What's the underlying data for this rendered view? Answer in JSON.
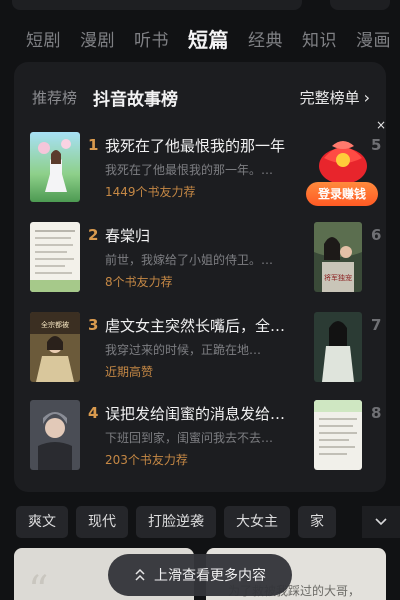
{
  "category_tabs": [
    "短剧",
    "漫剧",
    "听书",
    "短篇",
    "经典",
    "知识",
    "漫画"
  ],
  "active_tab": "短篇",
  "ranking": {
    "left_label": "推荐榜",
    "title": "抖音故事榜",
    "full_list_label": "完整榜单",
    "full_list_chevron": "›",
    "items": [
      {
        "rank": "1",
        "title": "我死在了他最恨我的那一年",
        "desc": "我死在了他最恨我的那一年。…",
        "meta": "1449个书友力荐",
        "right_rank": "5"
      },
      {
        "rank": "2",
        "title": "春棠归",
        "desc": "前世，我嫁给了小姐的侍卫。…",
        "meta": "8个书友力荐",
        "right_rank": "6"
      },
      {
        "rank": "3",
        "title": "虐文女主突然长嘴后，全…",
        "desc": "我穿过来的时候，正跪在地…",
        "meta": "近期高赞",
        "right_rank": "7"
      },
      {
        "rank": "4",
        "title": "误把发给闺蜜的消息发给…",
        "desc": "下班回到家，闺蜜问我去不去…",
        "meta": "203个书友力荐",
        "right_rank": "8"
      }
    ]
  },
  "cover_texts": {
    "item3_cover_title": "全宗都被",
    "right6_cover_title": "将军独宠"
  },
  "promo": {
    "button_label": "登录赚钱",
    "close_glyph": "×"
  },
  "filter_chips": [
    "爽文",
    "现代",
    "打脸逆袭",
    "大女主",
    "家"
  ],
  "bottom_card_right_text": "为了救被我踩过的大哥，",
  "scroll_hint": {
    "label": "上滑查看更多内容"
  },
  "colors": {
    "background": "#111214",
    "panel": "#1c1d20",
    "rank_accent": "#d99a4e",
    "meta_accent": "#c58845",
    "promo_orange": "#ff6a2b"
  },
  "icons": {
    "chevron_right": "chevron-right-icon",
    "chevron_down": "chevron-down-icon",
    "close": "close-icon",
    "swipe_up": "double-chevron-up-icon",
    "gift": "red-envelope-gift-icon"
  }
}
